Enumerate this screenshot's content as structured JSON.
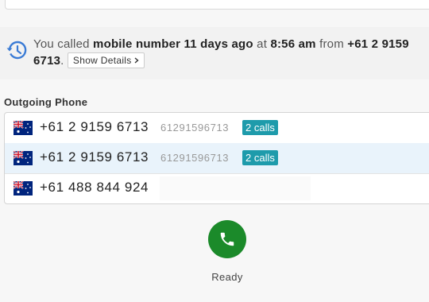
{
  "notice": {
    "prefix": "You called ",
    "target": "mobile number 11 days ago",
    "at_text": " at ",
    "time": "8:56 am",
    "from_text": " from ",
    "from_number": "+61 2 9159 6713",
    "period": ".",
    "details_label": "Show Details",
    "details_icon": "chevron-right-icon"
  },
  "outgoing": {
    "title": "Outgoing Phone",
    "rows": [
      {
        "number": "+61 2 9159 6713",
        "raw": "61291596713",
        "badge": "2 calls",
        "flag": "australia-flag-icon"
      },
      {
        "number": "+61 2 9159 6713",
        "raw": "61291596713",
        "badge": "2 calls",
        "flag": "australia-flag-icon"
      },
      {
        "number": "+61 488 844 924",
        "raw": "",
        "badge": "",
        "flag": "australia-flag-icon"
      }
    ]
  },
  "call": {
    "icon": "phone-icon",
    "status": "Ready"
  },
  "colors": {
    "badge": "#1e9bab",
    "call_button": "#1b8a2a",
    "selected_row": "#e9f3fb",
    "history_icon": "#3a7bd5"
  }
}
